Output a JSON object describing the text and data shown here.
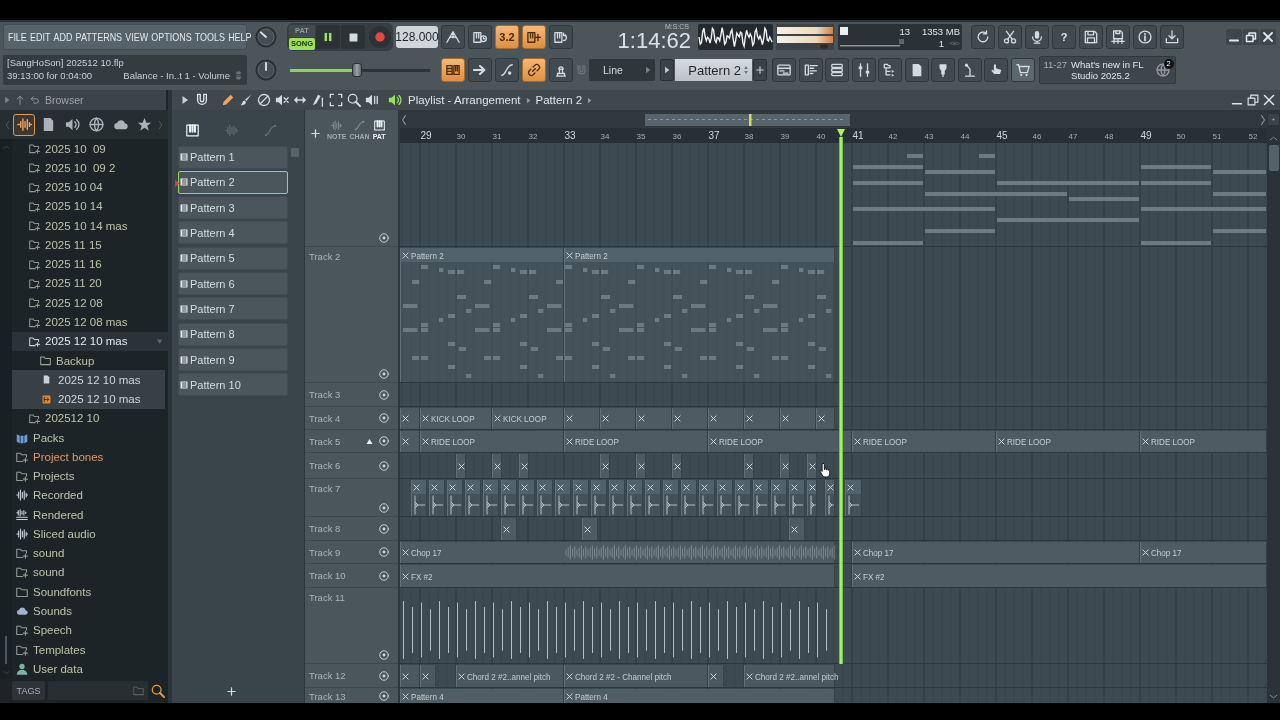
{
  "menu": [
    "FILE",
    "EDIT",
    "ADD",
    "PATTERNS",
    "VIEW",
    "OPTIONS",
    "TOOLS",
    "HELP"
  ],
  "transport": {
    "modes": [
      {
        "label": "PAT",
        "selected": false
      },
      {
        "label": "SONG",
        "selected": true
      }
    ],
    "playing": true,
    "tempo": "128.000"
  },
  "record_tools": [
    {
      "kind": "metronome",
      "on": false
    },
    {
      "kind": "wait",
      "on": false
    },
    {
      "kind": "countdown",
      "label": "3.2",
      "on": true
    },
    {
      "kind": "step",
      "on": true
    },
    {
      "kind": "blend",
      "on": false
    }
  ],
  "song_time": {
    "value": "1:14:62",
    "unit": "M:S:CS"
  },
  "performance": {
    "cpu": "13",
    "memory": "1353 MB",
    "voices": "1"
  },
  "app_tools": [
    {
      "kind": "refresh"
    },
    {
      "kind": "scissors"
    },
    {
      "kind": "microphone"
    },
    {
      "kind": "help",
      "label": "?"
    },
    {
      "kind": "save"
    },
    {
      "kind": "save-as"
    },
    {
      "kind": "info"
    },
    {
      "kind": "download"
    }
  ],
  "hint": {
    "project": "[SangHoSon] 202512 10.flp",
    "time": "39:13:00 for 0:04:00",
    "target": "Balance - In..t 1 - Volume"
  },
  "master_pitch": {
    "level": 0.48
  },
  "edit_tools": [
    {
      "kind": "piano-roll",
      "on": true
    },
    {
      "kind": "arrow",
      "on": false
    },
    {
      "kind": "note",
      "on": false
    },
    {
      "kind": "link",
      "on": true
    },
    {
      "kind": "stamp",
      "on": false
    }
  ],
  "snap": {
    "value": "Line"
  },
  "pattern_selector": {
    "value": "Pattern 2"
  },
  "window_tools": [
    {
      "kind": "playlist"
    },
    {
      "kind": "channel-rack"
    },
    {
      "kind": "list"
    },
    {
      "kind": "mixer"
    },
    {
      "kind": "tree"
    },
    {
      "kind": "file"
    },
    {
      "kind": "plug"
    },
    {
      "kind": "mic-stand"
    },
    {
      "kind": "hand"
    },
    {
      "kind": "cart"
    }
  ],
  "news": {
    "date": "11-27",
    "headline": "What's new in FL Studio 2025.2",
    "badge": "2"
  },
  "browser": {
    "title": "Browser",
    "tabs": [
      {
        "kind": "all",
        "selected": true
      },
      {
        "kind": "files",
        "selected": false
      },
      {
        "kind": "plugins",
        "selected": false
      },
      {
        "kind": "web",
        "selected": false
      },
      {
        "kind": "cloud",
        "selected": false
      },
      {
        "kind": "favorites",
        "selected": false
      }
    ],
    "folders": [
      {
        "label": "2025 10  09",
        "expanded": false
      },
      {
        "label": "2025 10  09 2",
        "expanded": false
      },
      {
        "label": "2025 10 04",
        "expanded": false
      },
      {
        "label": "2025 10 14",
        "expanded": false
      },
      {
        "label": "2025 10 14 mas",
        "expanded": false
      },
      {
        "label": "2025 11 15",
        "expanded": false
      },
      {
        "label": "2025 11 16",
        "expanded": false
      },
      {
        "label": "2025 11 20",
        "expanded": false
      },
      {
        "label": "2025 12 08",
        "expanded": false
      },
      {
        "label": "2025 12 08 mas",
        "expanded": false
      },
      {
        "label": "2025 12 10 mas",
        "expanded": true,
        "children": [
          {
            "label": "Backup",
            "kind": "folder"
          },
          {
            "label": "2025 12 10 mas",
            "kind": "file"
          },
          {
            "label": "2025 12 10 mas",
            "kind": "project"
          }
        ]
      },
      {
        "label": "202512 10",
        "expanded": false
      }
    ],
    "places": [
      {
        "label": "Packs",
        "kind": "packs",
        "color": "#b9c5a8"
      },
      {
        "label": "Project bones",
        "kind": "folder-plus",
        "color": "#d99a6c"
      },
      {
        "label": "Projects",
        "kind": "folder-plus",
        "color": "#b9c5a8"
      },
      {
        "label": "Recorded",
        "kind": "audio",
        "color": "#b9c5a8"
      },
      {
        "label": "Rendered",
        "kind": "rendered",
        "color": "#b9c5a8"
      },
      {
        "label": "Sliced audio",
        "kind": "audio",
        "color": "#b9c5a8"
      },
      {
        "label": "sound",
        "kind": "folder-plus",
        "color": "#b9c5a8"
      },
      {
        "label": "sound",
        "kind": "folder-plus",
        "color": "#b9c5a8"
      },
      {
        "label": "Soundfonts",
        "kind": "folder",
        "color": "#b9c5a8"
      },
      {
        "label": "Sounds",
        "kind": "cloud",
        "color": "#b9c5a8"
      },
      {
        "label": "Speech",
        "kind": "folder-plus",
        "color": "#b9c5a8"
      },
      {
        "label": "Templates",
        "kind": "folder-plus",
        "color": "#b9c5a8"
      },
      {
        "label": "User data",
        "kind": "user",
        "color": "#b9c5a8"
      }
    ],
    "tags": {
      "label": "TAGS"
    }
  },
  "playlist": {
    "title": "Playlist - Arrangement",
    "pattern": "Pattern 2",
    "tools": [
      {
        "kind": "pencil",
        "selected": true
      },
      {
        "kind": "paint",
        "selected": false
      },
      {
        "kind": "delete",
        "selected": false
      },
      {
        "kind": "mute",
        "selected": false
      },
      {
        "kind": "slip",
        "selected": false
      },
      {
        "kind": "slice",
        "selected": false
      },
      {
        "kind": "select",
        "selected": false
      },
      {
        "kind": "zoom",
        "selected": false
      },
      {
        "kind": "playback",
        "selected": false
      }
    ],
    "picker_modes": [
      {
        "kind": "piano",
        "selected": true
      },
      {
        "kind": "audio",
        "selected": false
      },
      {
        "kind": "automation",
        "selected": false
      }
    ],
    "patterns": [
      {
        "label": "Pattern 1",
        "selected": false
      },
      {
        "label": "Pattern 2",
        "selected": true
      },
      {
        "label": "Pattern 3",
        "selected": false
      },
      {
        "label": "Pattern 4",
        "selected": false
      },
      {
        "label": "Pattern 5",
        "selected": false
      },
      {
        "label": "Pattern 6",
        "selected": false
      },
      {
        "label": "Pattern 7",
        "selected": false
      },
      {
        "label": "Pattern 8",
        "selected": false
      },
      {
        "label": "Pattern 9",
        "selected": false
      },
      {
        "label": "Pattern 10",
        "selected": false
      }
    ],
    "track_modes": [
      {
        "kind": "audio",
        "label": "NOTE",
        "selected": false
      },
      {
        "kind": "automation",
        "label": "CHAN",
        "selected": false
      },
      {
        "kind": "piano",
        "label": "PAT",
        "selected": true
      }
    ],
    "ruler": [
      "29",
      "30",
      "31",
      "32",
      "33",
      "34",
      "35",
      "36",
      "37",
      "38",
      "39",
      "40",
      "41",
      "42",
      "43",
      "44",
      "45",
      "46",
      "47",
      "48",
      "49",
      "50",
      "51",
      "52"
    ],
    "playhead": {
      "level": 0.509
    },
    "tracks": [
      {
        "marker": false,
        "clips": [
          {
            "kind": "pattern"
          }
        ]
      },
      {
        "name": "Track 2",
        "marker": false,
        "clips": [
          {
            "kind": "pattern",
            "label": "Pattern 2"
          },
          {
            "kind": "pattern",
            "label": "Pattern 2"
          }
        ]
      },
      {
        "name": "Track 3",
        "marker": false
      },
      {
        "name": "Track 4",
        "marker": false,
        "clips": [
          {
            "kind": "audio"
          },
          {
            "kind": "audio",
            "label": "KICK LOOP"
          },
          {
            "kind": "audio",
            "label": "KICK LOOP"
          },
          {
            "kind": "audio"
          },
          {
            "kind": "audio"
          },
          {
            "kind": "audio"
          },
          {
            "kind": "audio"
          },
          {
            "kind": "audio"
          },
          {
            "kind": "audio"
          },
          {
            "kind": "audio"
          },
          {
            "kind": "audio"
          }
        ]
      },
      {
        "name": "Track 5",
        "marker": true,
        "clips": [
          {
            "kind": "audio"
          },
          {
            "kind": "audio",
            "label": "RIDE LOOP"
          },
          {
            "kind": "audio",
            "label": "RIDE LOOP"
          },
          {
            "kind": "audio",
            "label": "RIDE LOOP"
          },
          {
            "kind": "audio",
            "label": "RIDE LOOP"
          },
          {
            "kind": "audio",
            "label": "RIDE LOOP"
          },
          {
            "kind": "audio",
            "label": "RIDE LOOP"
          }
        ]
      },
      {
        "name": "Track 6",
        "marker": false,
        "clips": [
          {
            "kind": "audio"
          },
          {
            "kind": "audio"
          },
          {
            "kind": "audio"
          },
          {
            "kind": "audio"
          },
          {
            "kind": "audio"
          },
          {
            "kind": "audio"
          },
          {
            "kind": "audio"
          },
          {
            "kind": "audio"
          },
          {
            "kind": "audio"
          }
        ]
      },
      {
        "name": "Track 7",
        "marker": false,
        "clips": [
          {
            "kind": "audio"
          },
          {
            "kind": "audio"
          },
          {
            "kind": "audio"
          },
          {
            "kind": "audio"
          },
          {
            "kind": "audio"
          },
          {
            "kind": "audio"
          },
          {
            "kind": "audio"
          },
          {
            "kind": "audio"
          },
          {
            "kind": "audio"
          },
          {
            "kind": "audio"
          },
          {
            "kind": "audio"
          },
          {
            "kind": "audio"
          },
          {
            "kind": "audio"
          },
          {
            "kind": "audio"
          },
          {
            "kind": "audio"
          },
          {
            "kind": "audio"
          },
          {
            "kind": "audio"
          },
          {
            "kind": "audio"
          },
          {
            "kind": "audio"
          },
          {
            "kind": "audio"
          },
          {
            "kind": "audio"
          },
          {
            "kind": "audio"
          },
          {
            "kind": "audio"
          },
          {
            "kind": "audio"
          },
          {
            "kind": "audio"
          }
        ]
      },
      {
        "name": "Track 8",
        "marker": false,
        "clips": [
          {
            "kind": "audio"
          },
          {
            "kind": "audio"
          },
          {
            "kind": "audio"
          }
        ]
      },
      {
        "name": "Track 9",
        "marker": false,
        "clips": [
          {
            "kind": "audio",
            "label": "Chop 17"
          },
          {
            "kind": "audio",
            "label": "Chop 17"
          },
          {
            "kind": "audio",
            "label": "Chop 17"
          }
        ]
      },
      {
        "name": "Track 10",
        "marker": false,
        "clips": [
          {
            "kind": "audio",
            "label": "FX #2"
          },
          {
            "kind": "audio",
            "label": "FX #2"
          }
        ]
      },
      {
        "name": "Track 11",
        "marker": false,
        "clips": [
          {
            "kind": "audio"
          }
        ]
      },
      {
        "name": "Track 12",
        "marker": false,
        "clips": [
          {
            "kind": "automation"
          },
          {
            "kind": "automation"
          },
          {
            "kind": "automation",
            "label": "Chord 2 #2..annel pitch"
          },
          {
            "kind": "automation",
            "label": "Chord 2 #2 - Channel pitch"
          },
          {
            "kind": "automation"
          },
          {
            "kind": "automation",
            "label": "Chord 2 #2..annel pitch"
          }
        ]
      },
      {
        "name": "Track 13",
        "marker": false,
        "clips": [
          {
            "kind": "pattern",
            "label": "Pattern 4"
          },
          {
            "kind": "pattern",
            "label": "Pattern 4"
          }
        ]
      }
    ],
    "cursor": {
      "kind": "hand"
    }
  }
}
